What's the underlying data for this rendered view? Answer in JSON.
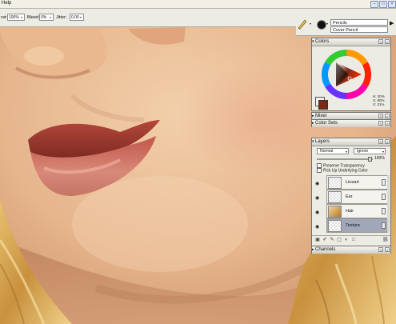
{
  "menubar": {
    "help_label": "Help"
  },
  "properties_bar": {
    "grain_label": "rat:",
    "grain_value": "100%",
    "bleed_label": "Bleed:",
    "bleed_value": "0%",
    "jitter_label": "Jitter:",
    "jitter_value": "0.00"
  },
  "brush_selector": {
    "category": "Pencils",
    "variant": "Cover Pencil"
  },
  "colors_panel": {
    "title": "Colors",
    "hsv": [
      "H: 20%",
      "S: 80%",
      "V: 31%"
    ],
    "current_color": "#7a2b18",
    "secondary_color": "#f2f0ea"
  },
  "collapsed_panels": {
    "mixer": "Mixer",
    "color_sets": "Color Sets"
  },
  "layers_panel": {
    "title": "Layers",
    "composite_method": "Normal",
    "composite_depth": "Ignore",
    "opacity": "100%",
    "preserve_transparency": "Preserve Transparency",
    "pick_up_color": "Pick Up Underlying Color",
    "layers": [
      {
        "name": "Lineart",
        "selected": false
      },
      {
        "name": "Ear",
        "selected": false
      },
      {
        "name": "Hair",
        "selected": false
      },
      {
        "name": "Texture",
        "selected": true
      }
    ]
  },
  "channels_panel": {
    "title": "Channels"
  },
  "icons": [
    "dropper-icon",
    "brush-icon",
    "eye-icon",
    "layer-visibility-icon",
    "trash-icon",
    "new-layer-icon"
  ]
}
